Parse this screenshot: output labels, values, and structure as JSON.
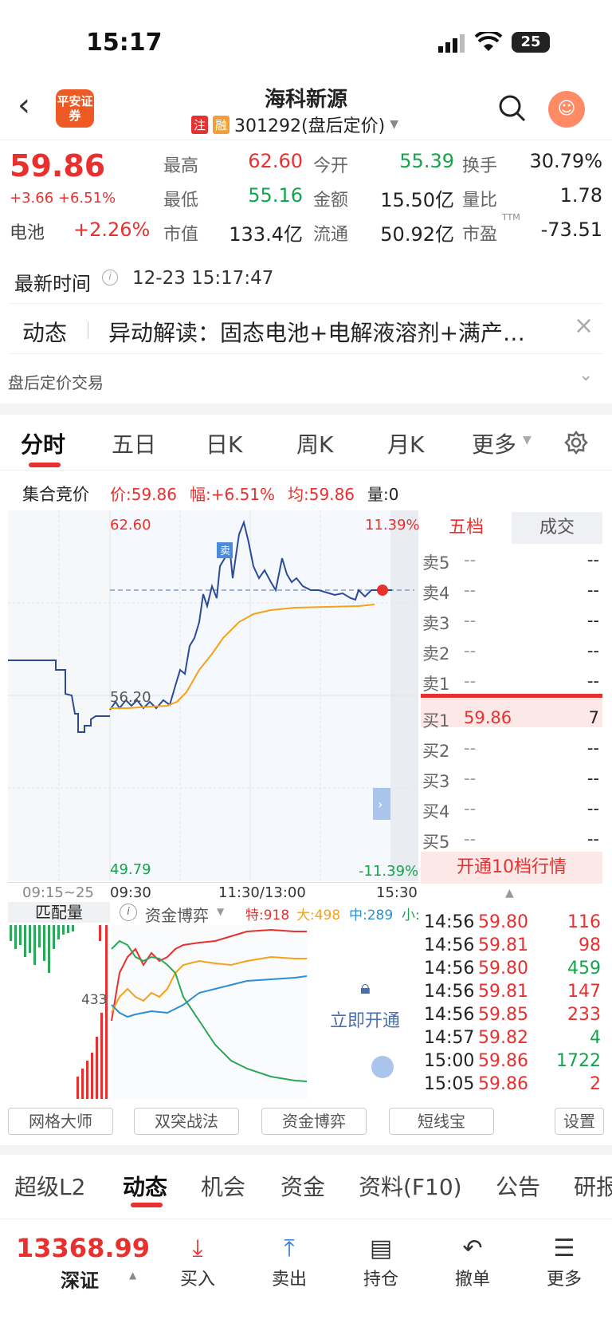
{
  "status": {
    "time": "15:17",
    "battery": "25"
  },
  "nav": {
    "logo": "平安证券",
    "title": "海科新源",
    "tag1": "注",
    "tag2": "融",
    "code": "301292(盘后定价)"
  },
  "quote": {
    "price": "59.86",
    "change": "+3.66 +6.51%",
    "sector": "电池",
    "sector_change": "+2.26%",
    "fields": [
      {
        "k": "最高",
        "v": "62.60"
      },
      {
        "k": "今开",
        "v": "55.39"
      },
      {
        "k": "换手",
        "v": "30.79%"
      },
      {
        "k": "最低",
        "v": "55.16"
      },
      {
        "k": "金额",
        "v": "15.50亿"
      },
      {
        "k": "量比",
        "v": "1.78"
      },
      {
        "k": "市值",
        "v": "133.4亿"
      },
      {
        "k": "流通",
        "v": "50.92亿"
      },
      {
        "k": "市盈",
        "v": "-73.51"
      }
    ],
    "pe_sup": "TTM"
  },
  "update": {
    "label": "最新时间",
    "time": "12-23 15:17:47"
  },
  "news": {
    "label": "动态",
    "text": "异动解读：固态电池+电解液溶剂+满产…"
  },
  "after": {
    "label": "盘后定价交易"
  },
  "tabs": [
    "分时",
    "五日",
    "日K",
    "周K",
    "月K",
    "更多"
  ],
  "info": {
    "label": "集合竞价",
    "price": "价:59.86",
    "amp": "幅:+6.51%",
    "avg": "均:59.86",
    "vol": "量:0"
  },
  "chart": {
    "high": "62.60",
    "mid": "56.20",
    "low": "49.79",
    "pct_high": "11.39%",
    "pct_low": "-11.39%",
    "t0": "09:15~25",
    "t1": "09:30",
    "t2": "11:30/13:00",
    "t3": "15:30",
    "sell_mark": "卖"
  },
  "sub": {
    "label": "匹配量",
    "fund": "资金博弈",
    "te": "特:918",
    "da": "大:498",
    "zhong": "中:289",
    "xiao": "小:",
    "val": "433",
    "unlock": "立即开通"
  },
  "orderbook": {
    "tab1": "五档",
    "tab2": "成交",
    "rows": [
      {
        "n": "卖5",
        "p": "--",
        "v": "--"
      },
      {
        "n": "卖4",
        "p": "--",
        "v": "--"
      },
      {
        "n": "卖3",
        "p": "--",
        "v": "--"
      },
      {
        "n": "卖2",
        "p": "--",
        "v": "--"
      },
      {
        "n": "卖1",
        "p": "--",
        "v": "--"
      },
      {
        "n": "买1",
        "p": "59.86",
        "v": "7"
      },
      {
        "n": "买2",
        "p": "--",
        "v": "--"
      },
      {
        "n": "买3",
        "p": "--",
        "v": "--"
      },
      {
        "n": "买4",
        "p": "--",
        "v": "--"
      },
      {
        "n": "买5",
        "p": "--",
        "v": "--"
      }
    ],
    "open10": "开通10档行情"
  },
  "trades": [
    {
      "t": "14:56",
      "p": "59.80",
      "v": "116",
      "c": "red"
    },
    {
      "t": "14:56",
      "p": "59.81",
      "v": "98",
      "c": "red"
    },
    {
      "t": "14:56",
      "p": "59.80",
      "v": "459",
      "c": "green"
    },
    {
      "t": "14:56",
      "p": "59.81",
      "v": "147",
      "c": "red"
    },
    {
      "t": "14:56",
      "p": "59.85",
      "v": "233",
      "c": "red"
    },
    {
      "t": "14:57",
      "p": "59.82",
      "v": "4",
      "c": "green"
    },
    {
      "t": "15:00",
      "p": "59.86",
      "v": "1722",
      "c": "green"
    },
    {
      "t": "15:05",
      "p": "59.86",
      "v": "2",
      "c": "red"
    }
  ],
  "tools": [
    "网格大师",
    "双突战法",
    "资金博弈",
    "短线宝",
    "设置"
  ],
  "bottom_tabs": [
    "超级L2",
    "动态",
    "机会",
    "资金",
    "资料(F10)",
    "公告",
    "研报"
  ],
  "footer": {
    "index": "13368.99",
    "index_name": "深证",
    "buy": "买入",
    "sell": "卖出",
    "hold": "持仓",
    "cancel": "撤单",
    "more": "更多"
  }
}
